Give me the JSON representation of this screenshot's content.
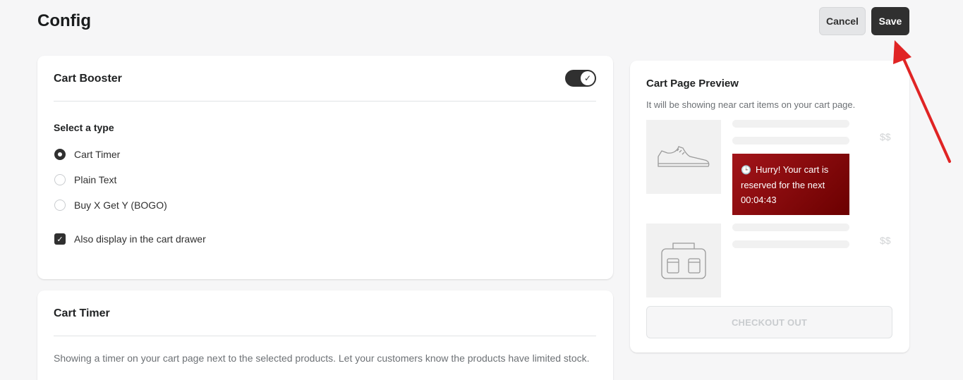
{
  "header": {
    "title": "Config",
    "cancel_label": "Cancel",
    "save_label": "Save"
  },
  "booster": {
    "title": "Cart Booster",
    "toggle_on": true,
    "type_label": "Select a type",
    "types": [
      {
        "label": "Cart Timer",
        "checked": true
      },
      {
        "label": "Plain Text",
        "checked": false
      },
      {
        "label": "Buy X Get Y (BOGO)",
        "checked": false
      }
    ],
    "drawer_label": "Also display in the cart drawer",
    "drawer_checked": true
  },
  "timer": {
    "title": "Cart Timer",
    "description": "Showing a timer on your cart page next to the selected products. Let your customers know the products have limited stock."
  },
  "preview": {
    "title": "Cart Page Preview",
    "subtitle": "It will be showing near cart items on your cart page.",
    "price_placeholder": "$$",
    "hurry_line1": "Hurry! Your cart is",
    "hurry_line2": "reserved for the next",
    "hurry_time": "00:04:43",
    "checkout_label": "CHECKOUT OUT",
    "accent_color": "#8b0000"
  },
  "annotation": {
    "arrow_color": "#e02424"
  }
}
